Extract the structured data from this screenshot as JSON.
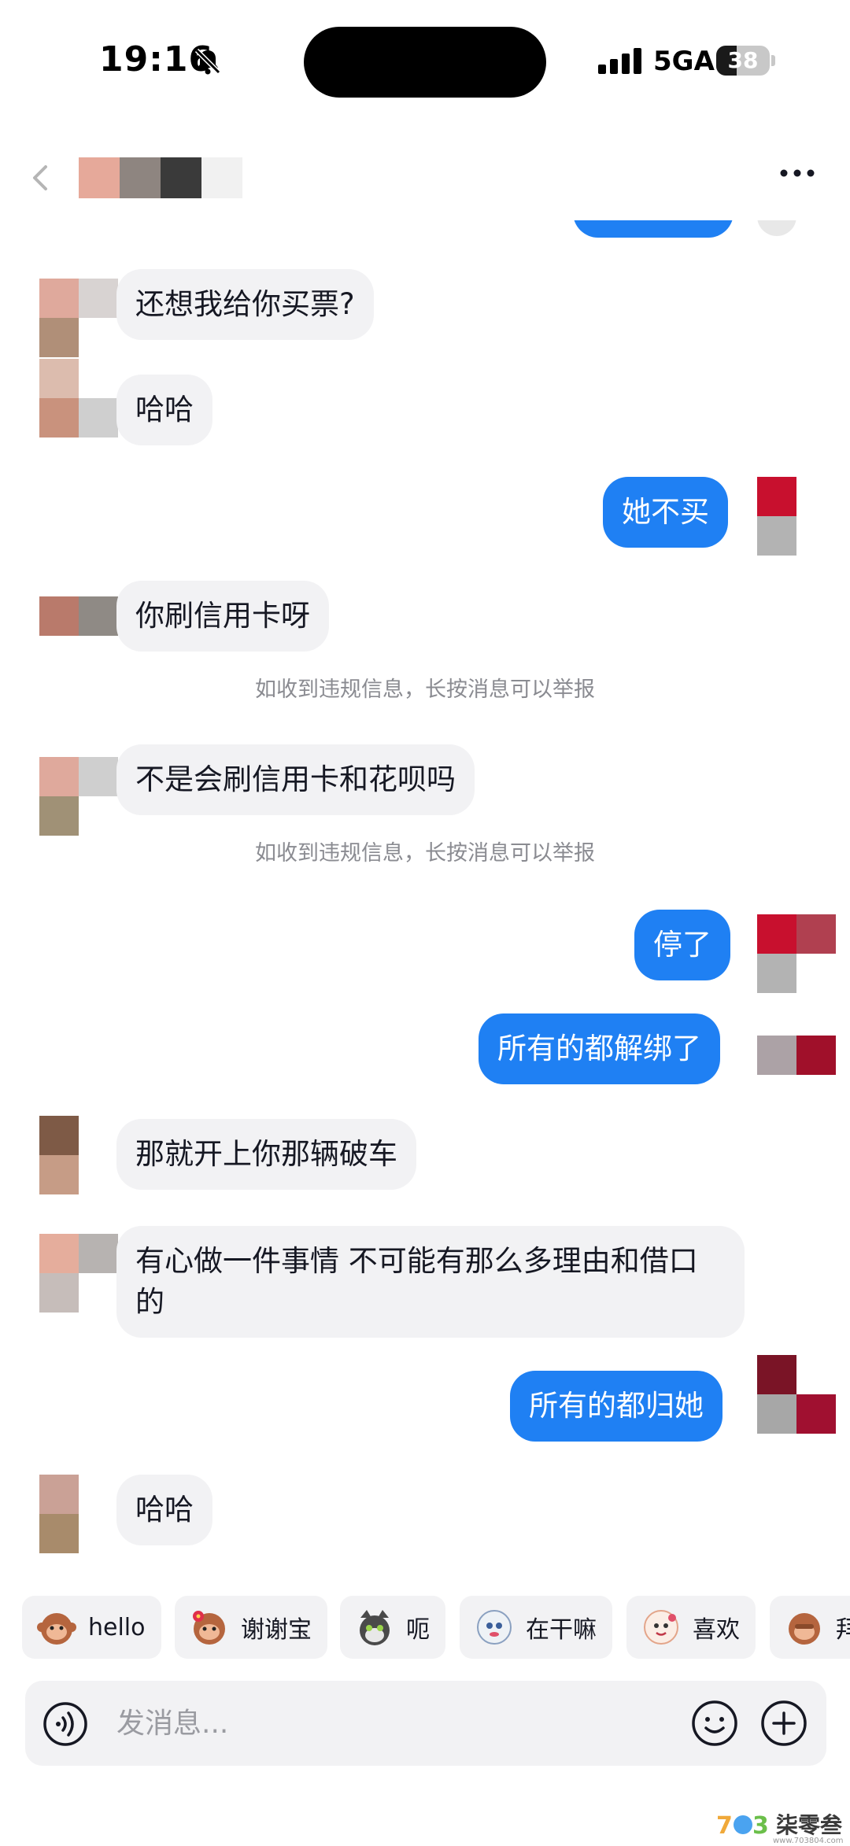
{
  "status_bar": {
    "time": "19:16",
    "network": "5GA",
    "battery_level": 38,
    "battery_text": "38",
    "muted": true
  },
  "header": {
    "back_icon": "chevron-left-icon",
    "contact_avatar": "pixelated-avatar",
    "more_icon": "more-dots-icon"
  },
  "messages": [
    {
      "from": "them",
      "text": "还想我给你买票?"
    },
    {
      "from": "them",
      "text": "哈哈"
    },
    {
      "from": "me",
      "text": "她不买"
    },
    {
      "from": "them",
      "text": "你刷信用卡呀"
    },
    {
      "system": "如收到违规信息，长按消息可以举报"
    },
    {
      "from": "them",
      "text": "不是会刷信用卡和花呗吗"
    },
    {
      "system": "如收到违规信息，长按消息可以举报"
    },
    {
      "from": "me",
      "text": "停了"
    },
    {
      "from": "me",
      "text": "所有的都解绑了"
    },
    {
      "from": "them",
      "text": "那就开上你那辆破车"
    },
    {
      "from": "them",
      "text": "有心做一件事情 不可能有那么多理由和借口",
      "text_line2": "的"
    },
    {
      "from": "me",
      "text": "所有的都归她"
    },
    {
      "from": "them",
      "text": "哈哈"
    }
  ],
  "quick_replies": [
    {
      "label": "hello",
      "icon": "monkey-emoji-icon"
    },
    {
      "label": "谢谢宝",
      "icon": "monkey-flower-emoji-icon"
    },
    {
      "label": "呃",
      "icon": "cat-emoji-icon"
    },
    {
      "label": "在干嘛",
      "icon": "peek-emoji-icon"
    },
    {
      "label": "喜欢",
      "icon": "hug-emoji-icon"
    },
    {
      "label": "拜",
      "icon": "monkey-bow-emoji-icon"
    }
  ],
  "composer": {
    "placeholder": "发消息...",
    "voice_icon": "voice-icon",
    "emoji_icon": "smile-icon",
    "add_icon": "plus-icon"
  },
  "watermark": {
    "text": "柒零叁",
    "sub": "www.703804.com"
  },
  "colors": {
    "outgoing_bubble": "#1f80f3",
    "incoming_bubble": "#f2f2f4",
    "system_text": "#8a8b91"
  }
}
